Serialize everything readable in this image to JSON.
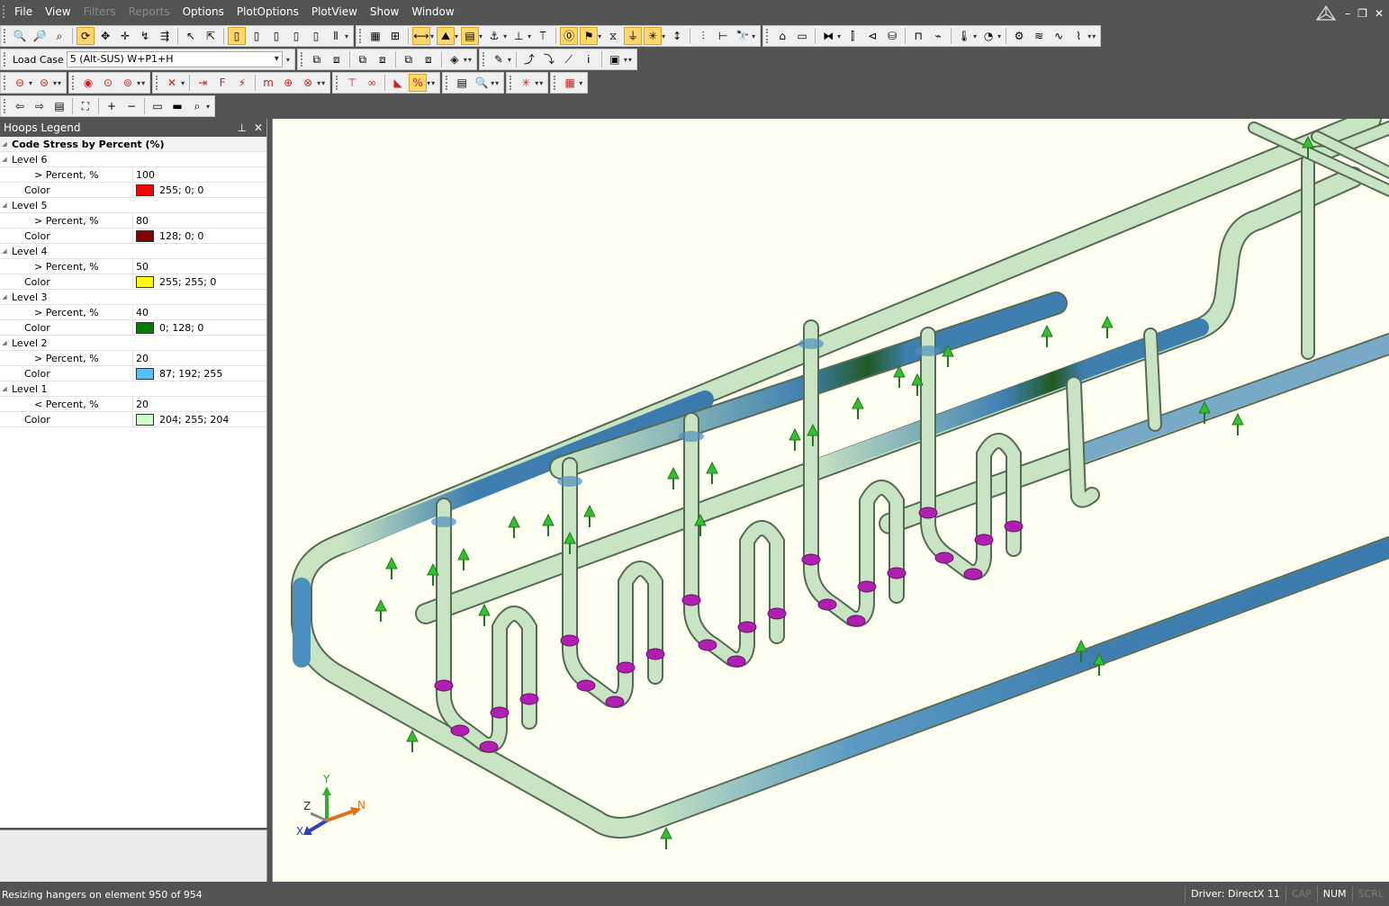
{
  "menu": {
    "items": [
      {
        "label": "File",
        "disabled": false
      },
      {
        "label": "View",
        "disabled": false
      },
      {
        "label": "Filters",
        "disabled": true
      },
      {
        "label": "Reports",
        "disabled": true
      },
      {
        "label": "Options",
        "disabled": false
      },
      {
        "label": "PlotOptions",
        "disabled": false
      },
      {
        "label": "PlotView",
        "disabled": false
      },
      {
        "label": "Show",
        "disabled": false
      },
      {
        "label": "Window",
        "disabled": false
      }
    ]
  },
  "load_case": {
    "label": "Load Case",
    "value": "5 (Alt-SUS) W+P1+H"
  },
  "legend": {
    "panel_title": "Hoops Legend",
    "category": "Code Stress by Percent (%)",
    "levels": [
      {
        "name": "Level 6",
        "percent_label": "> Percent, %",
        "percent": "100",
        "color_label": "Color",
        "color_value": "255; 0; 0",
        "swatch": "#ff0000"
      },
      {
        "name": "Level 5",
        "percent_label": "> Percent, %",
        "percent": "80",
        "color_label": "Color",
        "color_value": "128; 0; 0",
        "swatch": "#800000"
      },
      {
        "name": "Level 4",
        "percent_label": "> Percent, %",
        "percent": "50",
        "color_label": "Color",
        "color_value": "255; 255; 0",
        "swatch": "#ffff00"
      },
      {
        "name": "Level 3",
        "percent_label": "> Percent, %",
        "percent": "40",
        "color_label": "Color",
        "color_value": "0; 128; 0",
        "swatch": "#008000"
      },
      {
        "name": "Level 2",
        "percent_label": "> Percent, %",
        "percent": "20",
        "color_label": "Color",
        "color_value": "87; 192; 255",
        "swatch": "#57c0ff"
      },
      {
        "name": "Level 1",
        "percent_label": "< Percent, %",
        "percent": "20",
        "color_label": "Color",
        "color_value": "204; 255; 204",
        "swatch": "#ccffcc"
      }
    ]
  },
  "axes": {
    "x": "X",
    "y": "Y",
    "z": "Z",
    "north": "N"
  },
  "status": {
    "message": "Resizing hangers on element 950 of 954",
    "driver": "Driver: DirectX 11",
    "cap": "CAP",
    "num": "NUM",
    "scrl": "SCRL"
  },
  "colors": {
    "pipe_base": "#c8e4c2",
    "pipe_blue": "#3f7fb0",
    "pipe_green": "#1f5a20",
    "restraint": "#30c030",
    "flange": "#b020b0",
    "viewport_bg": "#fefff0"
  }
}
